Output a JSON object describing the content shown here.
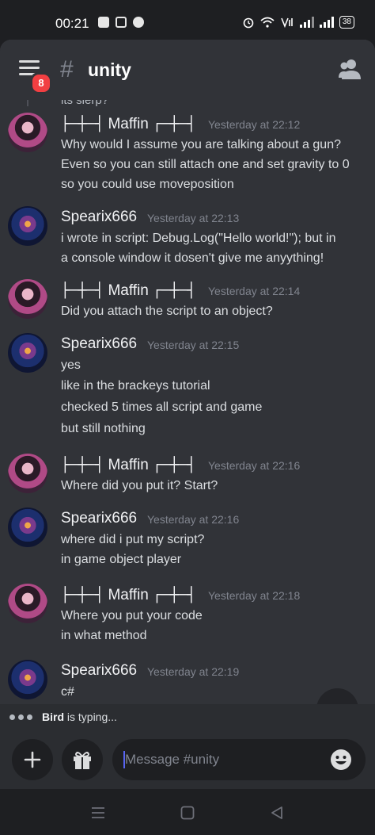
{
  "status_bar": {
    "time": "00:21",
    "battery": "38",
    "left_icons": [
      "discord-icon",
      "instagram-icon",
      "reddit-icon"
    ],
    "right_icons": [
      "alarm-icon",
      "wifi-icon",
      "volte-icon",
      "signal-icon",
      "signal-icon",
      "battery-icon"
    ]
  },
  "header": {
    "unread_badge": "8",
    "channel_hash": "#",
    "channel_name": "unity"
  },
  "messages": {
    "cutoff_text": "its slerp?",
    "items": [
      {
        "author": "Maffin",
        "deco_left": "├─┼─┤",
        "deco_right": "┌─┼─┤",
        "time": "Yesterday at 22:12",
        "lines": [
          "Why would I assume you are talking about a gun?",
          "Even so you can still attach one and set gravity to 0",
          "so you could use moveposition"
        ]
      },
      {
        "author": "Spearix666",
        "time": "Yesterday at 22:13",
        "lines": [
          "i wrote in script: Debug.Log(\"Hello world!\"); but in",
          "a console window it dosen't give me anyything!"
        ]
      },
      {
        "author": "Maffin",
        "deco_left": "├─┼─┤",
        "deco_right": "┌─┼─┤",
        "time": "Yesterday at 22:14",
        "lines": [
          "Did you attach the script to an object?"
        ]
      },
      {
        "author": "Spearix666",
        "time": "Yesterday at 22:15",
        "lines": [
          "yes",
          "like in the brackeys tutorial",
          "checked 5 times all script and game",
          "but still nothing"
        ]
      },
      {
        "author": "Maffin",
        "deco_left": "├─┼─┤",
        "deco_right": "┌─┼─┤",
        "time": "Yesterday at 22:16",
        "lines": [
          "Where did you put it? Start?"
        ]
      },
      {
        "author": "Spearix666",
        "time": "Yesterday at 22:16",
        "lines": [
          "where did i put my script?",
          "in game object player"
        ]
      },
      {
        "author": "Maffin",
        "deco_left": "├─┼─┤",
        "deco_right": "┌─┼─┤",
        "time": "Yesterday at 22:18",
        "lines": [
          "Where you put your code",
          "in what method"
        ]
      },
      {
        "author": "Spearix666",
        "time": "Yesterday at 22:19",
        "lines": [
          "c#"
        ]
      }
    ]
  },
  "typing": {
    "user": "Bird",
    "text": " is typing..."
  },
  "composer": {
    "placeholder": "Message #unity"
  },
  "colors": {
    "background": "#313338",
    "accent": "#5865f2",
    "badge": "#f23f42"
  }
}
